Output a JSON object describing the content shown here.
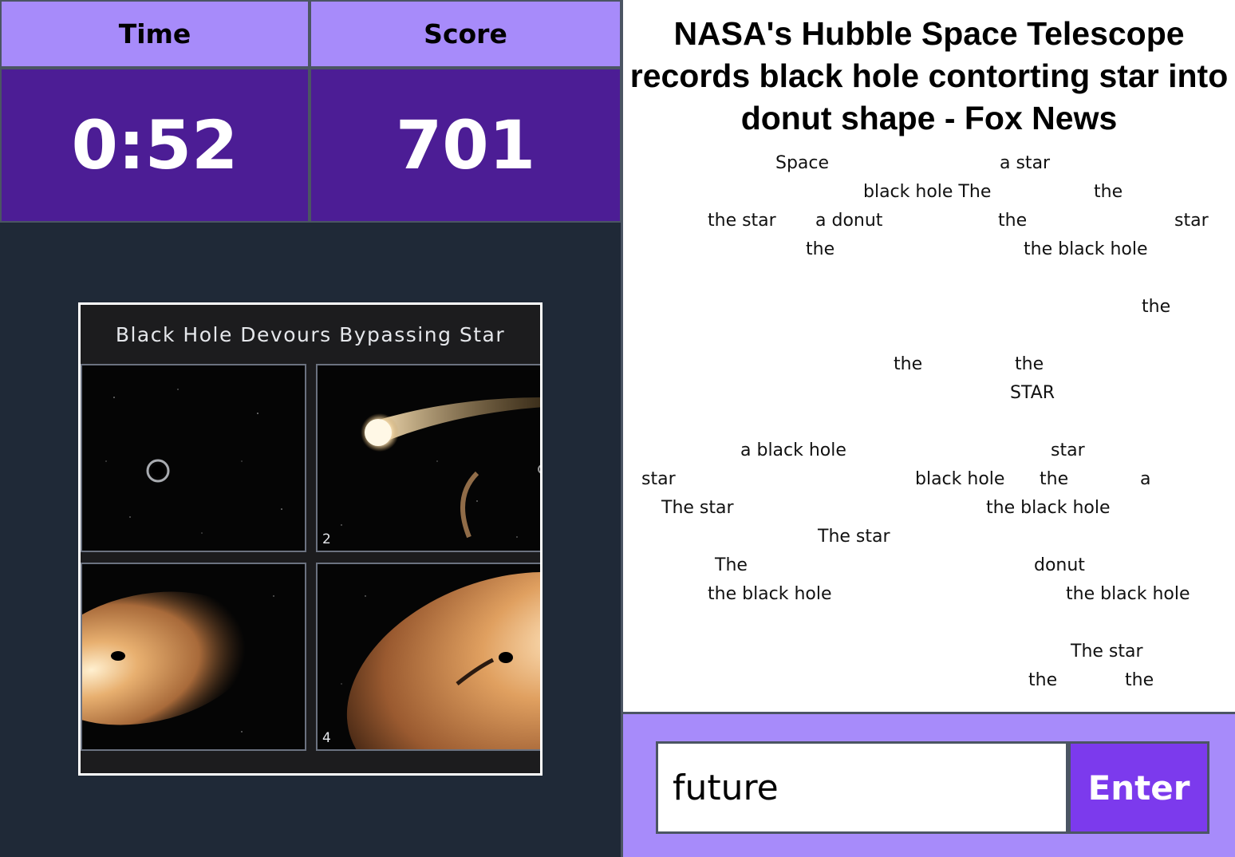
{
  "stats": {
    "time_label": "Time",
    "score_label": "Score",
    "time_value": "0:52",
    "score_value": "701"
  },
  "image": {
    "caption": "Black Hole Devours Bypassing Star",
    "panels": [
      {
        "number": ""
      },
      {
        "number": "2"
      },
      {
        "number": ""
      },
      {
        "number": "4"
      }
    ]
  },
  "headline": "NASA's Hubble Space Telescope records black hole contorting star into donut shape - Fox News",
  "revealed_words": [
    "Space",
    "a star",
    "black hole The",
    "the",
    "the star",
    "a donut",
    "the",
    "star",
    "the",
    "the black hole",
    "the",
    "the",
    "the",
    "STAR",
    "a black hole",
    "star",
    "star",
    "black hole",
    "the",
    "a",
    "The star",
    "the black hole",
    "The star",
    "The",
    "donut",
    "the black hole",
    "the black hole",
    "The star",
    "the",
    "the"
  ],
  "input": {
    "value": "future",
    "button_label": "Enter"
  },
  "colors": {
    "header_bg": "#a78bfa",
    "value_bg": "#4c1d95",
    "left_panel_bg": "#1f2937",
    "button_bg": "#7c3aed"
  }
}
